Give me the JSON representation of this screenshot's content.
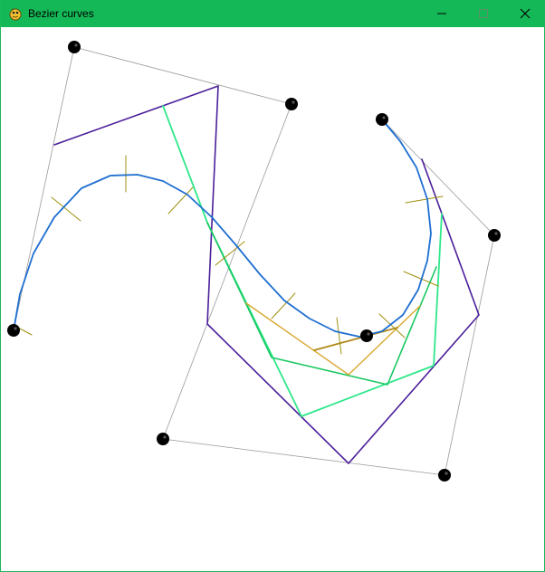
{
  "window": {
    "title": "Bezier curves",
    "app_icon": "pygame-snake-icon",
    "controls": [
      {
        "name": "minimize-button",
        "icon": "minimize-icon"
      },
      {
        "name": "maximize-button",
        "icon": "maximize-icon"
      },
      {
        "name": "close-button",
        "icon": "close-icon"
      }
    ]
  },
  "scene": {
    "colors": {
      "control_polygon": "#9a9a9a",
      "control_point": "#000000",
      "curve": "#1f6fd0",
      "level1": "#4b1e9a",
      "level2": "#2ee88a",
      "level3": "#18c860",
      "level4": "#d8a830",
      "level5": "#b08a18",
      "tick": "#a09010"
    }
  }
}
